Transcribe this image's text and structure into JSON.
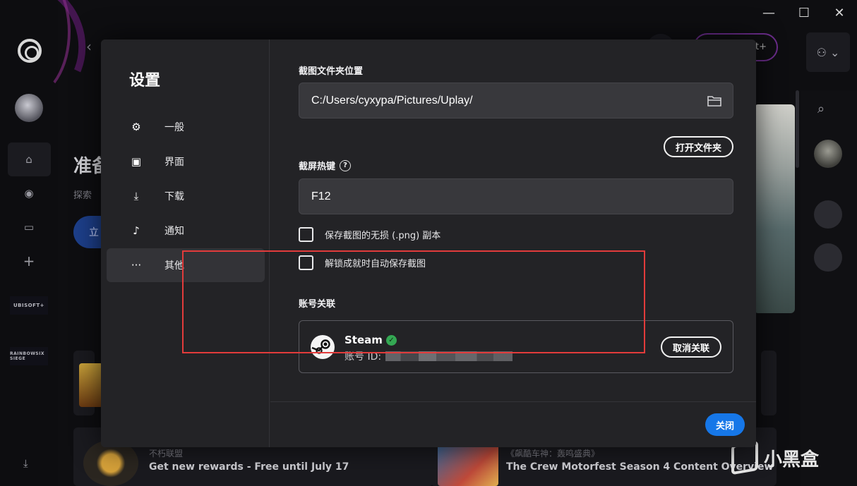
{
  "window": {
    "minimize": "—",
    "maximize": "☐",
    "close": "✕"
  },
  "background": {
    "title_partial": "准备",
    "subtitle_partial": "探索",
    "pill_partial": "立",
    "plus_pill": "t+",
    "rail_tiles": [
      "UBISOFT+",
      "RAINBOWSIX SIEGE"
    ],
    "news": [
      {
        "category": "不朽联盟",
        "title": "Get new rewards - Free until July 17"
      },
      {
        "category": "《飙酷车神：轰鸣盛典》",
        "title": "The Crew Motorfest Season 4 Content Overview"
      }
    ],
    "watermark": "小黑盒"
  },
  "settings": {
    "title": "设置",
    "nav": [
      {
        "icon": "gear-icon",
        "label": "一般"
      },
      {
        "icon": "monitor-icon",
        "label": "界面"
      },
      {
        "icon": "download-icon",
        "label": "下载"
      },
      {
        "icon": "bell-icon",
        "label": "通知"
      },
      {
        "icon": "more-icon",
        "label": "其他",
        "active": true
      }
    ],
    "screenshot_folder": {
      "label": "截图文件夹位置",
      "value": "C:/Users/cyxypa/Pictures/Uplay/",
      "open_button": "打开文件夹"
    },
    "hotkey": {
      "label": "截屏热键",
      "help": "?",
      "value": "F12"
    },
    "checkboxes": [
      {
        "label": "保存截图的无损 (.png) 副本",
        "checked": false
      },
      {
        "label": "解锁成就时自动保存截图",
        "checked": false
      }
    ],
    "account_link": {
      "label": "账号关联",
      "service": "Steam",
      "id_label": "账号 ID:",
      "unlink_button": "取消关联"
    },
    "close_button": "关闭"
  },
  "colors": {
    "accent": "#1677e8",
    "highlight": "#e23b3b",
    "verified": "#34a853"
  }
}
